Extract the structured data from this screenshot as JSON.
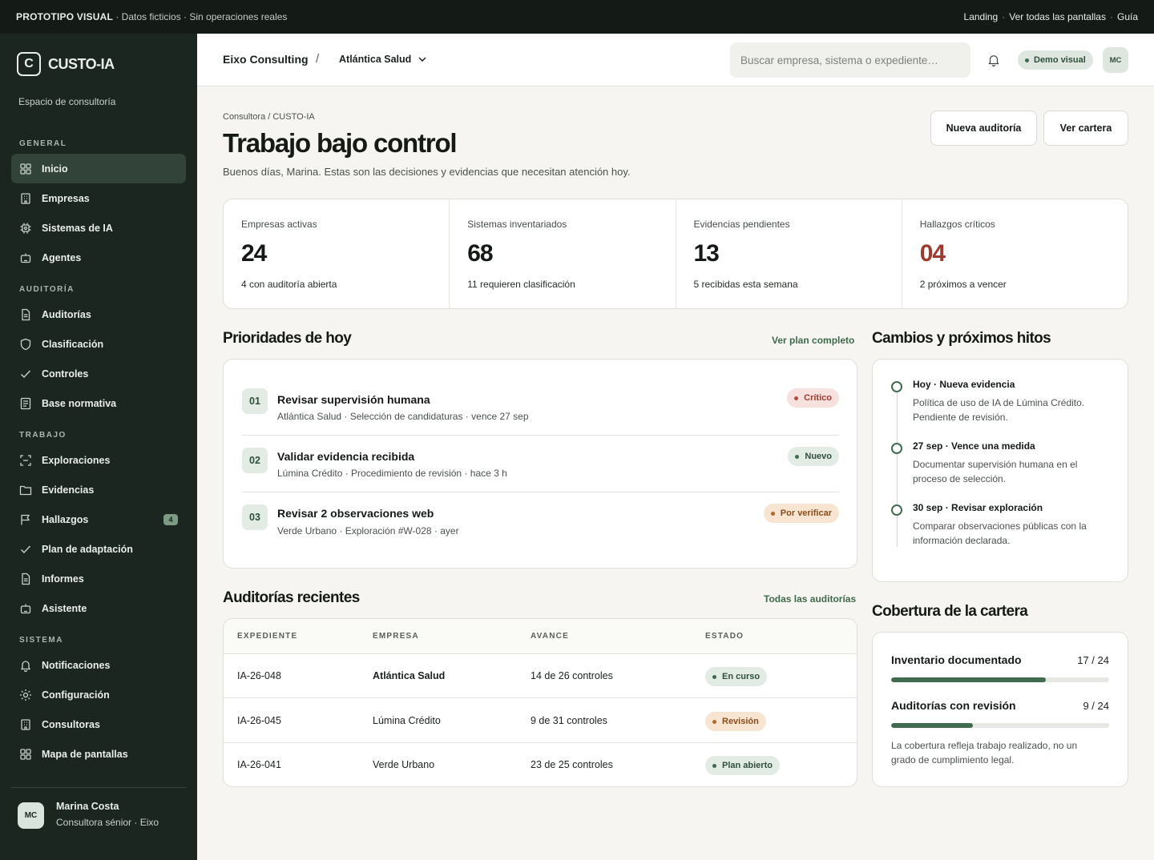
{
  "banner": {
    "brand": "PROTOTIPO VISUAL",
    "note": "· Datos ficticios · Sin operaciones reales",
    "links": [
      "Landing",
      "Ver todas las pantallas",
      "Guía"
    ]
  },
  "sidebar": {
    "logo_letter": "C",
    "app_name": "CUSTO-IA",
    "workspace": "Espacio de consultoría",
    "sections": [
      {
        "title": "GENERAL",
        "items": [
          {
            "label": "Inicio",
            "icon": "grid-icon",
            "active": true
          },
          {
            "label": "Empresas",
            "icon": "building-icon"
          },
          {
            "label": "Sistemas de IA",
            "icon": "chip-icon"
          },
          {
            "label": "Agentes",
            "icon": "bot-icon"
          }
        ]
      },
      {
        "title": "AUDITORÍA",
        "items": [
          {
            "label": "Auditorías",
            "icon": "document-icon"
          },
          {
            "label": "Clasificación",
            "icon": "shield-icon"
          },
          {
            "label": "Controles",
            "icon": "check-icon"
          },
          {
            "label": "Base normativa",
            "icon": "list-doc-icon"
          }
        ]
      },
      {
        "title": "TRABAJO",
        "items": [
          {
            "label": "Exploraciones",
            "icon": "scan-icon"
          },
          {
            "label": "Evidencias",
            "icon": "folder-icon"
          },
          {
            "label": "Hallazgos",
            "icon": "flag-icon",
            "badge": "4"
          },
          {
            "label": "Plan de adaptación",
            "icon": "check-icon"
          },
          {
            "label": "Informes",
            "icon": "document-icon"
          },
          {
            "label": "Asistente",
            "icon": "bot-icon"
          }
        ]
      },
      {
        "title": "SISTEMA",
        "items": [
          {
            "label": "Notificaciones",
            "icon": "bell-icon"
          },
          {
            "label": "Configuración",
            "icon": "sun-gear-icon"
          },
          {
            "label": "Consultoras",
            "icon": "building-icon"
          },
          {
            "label": "Mapa de pantallas",
            "icon": "grid-icon"
          }
        ]
      }
    ],
    "user": {
      "initials": "MC",
      "name": "Marina Costa",
      "role": "Consultora sénior · Eixo"
    }
  },
  "header": {
    "org": "Eixo Consulting",
    "separator": "/",
    "company": "Atlántica Salud",
    "search_placeholder": "Buscar empresa, sistema o expediente…",
    "demo_label": "Demo visual",
    "initials": "MC"
  },
  "page": {
    "breadcrumb": "Consultora / CUSTO-IA",
    "title": "Trabajo bajo control",
    "subtitle": "Buenos días, Marina. Estas son las decisiones y evidencias que necesitan atención hoy.",
    "btn_new": "Nueva auditoría",
    "btn_cartera": "Ver cartera"
  },
  "stats": [
    {
      "label": "Empresas activas",
      "value": "24",
      "note": "4 con auditoría abierta"
    },
    {
      "label": "Sistemas inventariados",
      "value": "68",
      "note": "11 requieren clasificación"
    },
    {
      "label": "Evidencias pendientes",
      "value": "13",
      "note": "5 recibidas esta semana"
    },
    {
      "label": "Hallazgos críticos",
      "value": "04",
      "note": "2 próximos a vencer",
      "accent": "#9c3b2f"
    }
  ],
  "priorities": {
    "title": "Prioridades de hoy",
    "link": "Ver plan completo",
    "items": [
      {
        "num": "01",
        "title": "Revisar supervisión humana",
        "sub": "Atlántica Salud · Selección de candidaturas · vence 27 sep",
        "status": "Crítico",
        "tone": "red"
      },
      {
        "num": "02",
        "title": "Validar evidencia recibida",
        "sub": "Lúmina Crédito · Procedimiento de revisión · hace 3 h",
        "status": "Nuevo",
        "tone": "green"
      },
      {
        "num": "03",
        "title": "Revisar 2 observaciones web",
        "sub": "Verde Urbano · Exploración #W-028 · ayer",
        "status": "Por verificar",
        "tone": "orange"
      }
    ]
  },
  "milestones": {
    "title": "Cambios y próximos hitos",
    "items": [
      {
        "title": "Hoy · Nueva evidencia",
        "text": "Política de uso de IA de Lúmina Crédito. Pendiente de revisión."
      },
      {
        "title": "27 sep · Vence una medida",
        "text": "Documentar supervisión humana en el proceso de selección."
      },
      {
        "title": "30 sep · Revisar exploración",
        "text": "Comparar observaciones públicas con la información declarada."
      }
    ]
  },
  "audits": {
    "title": "Auditorías recientes",
    "link": "Todas las auditorías",
    "columns": [
      "EXPEDIENTE",
      "EMPRESA",
      "AVANCE",
      "ESTADO"
    ],
    "rows": [
      {
        "id": "IA-26-048",
        "company": "Atlántica Salud",
        "progress": "14 de 26 controles",
        "status": "En curso",
        "tone": "green",
        "bold": true
      },
      {
        "id": "IA-26-045",
        "company": "Lúmina Crédito",
        "progress": "9 de 31 controles",
        "status": "Revisión",
        "tone": "orange"
      },
      {
        "id": "IA-26-041",
        "company": "Verde Urbano",
        "progress": "23 de 25 controles",
        "status": "Plan abierto",
        "tone": "green"
      }
    ]
  },
  "coverage": {
    "title": "Cobertura de la cartera",
    "items": [
      {
        "label": "Inventario documentado",
        "value": "17  /  24",
        "fraction": 0.708
      },
      {
        "label": "Auditorías con revisión",
        "value": "9  /  24",
        "fraction": 0.375
      }
    ],
    "note": "La cobertura refleja trabajo realizado, no un grado de cumplimiento legal."
  }
}
